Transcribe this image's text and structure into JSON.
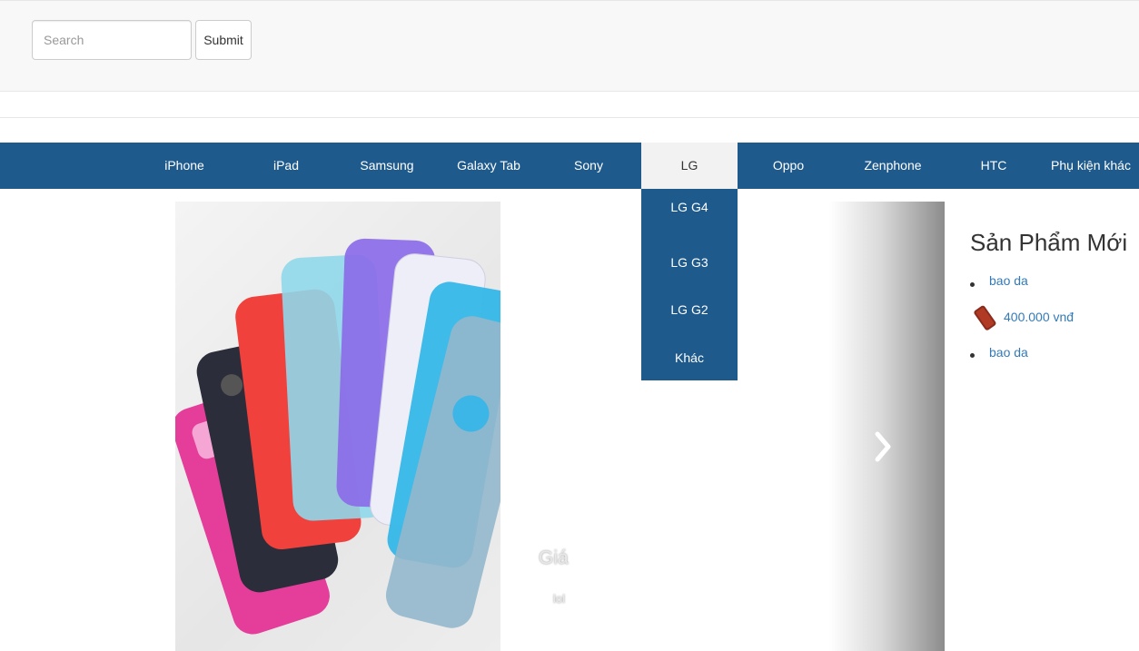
{
  "search": {
    "placeholder": "Search",
    "submit_label": "Submit"
  },
  "nav": {
    "items": [
      {
        "label": "iPhone"
      },
      {
        "label": "iPad"
      },
      {
        "label": "Samsung"
      },
      {
        "label": "Galaxy Tab"
      },
      {
        "label": "Sony"
      },
      {
        "label": "LG"
      },
      {
        "label": "Oppo"
      },
      {
        "label": "Zenphone"
      },
      {
        "label": "HTC"
      },
      {
        "label": "Phụ kiện khác"
      }
    ],
    "active": "LG"
  },
  "dropdown": {
    "items": [
      {
        "label": "LG G4"
      },
      {
        "label": "LG G3"
      },
      {
        "label": "LG G2"
      },
      {
        "label": "Khác"
      }
    ]
  },
  "carousel": {
    "caption_title": "Giá",
    "caption_value": "lol"
  },
  "sidebar": {
    "title": "Sản Phẩm Mới",
    "items": [
      {
        "name": "bao da"
      },
      {
        "price": "400.000 vnđ"
      },
      {
        "name": "bao da"
      }
    ]
  },
  "colors": {
    "nav_background": "#1f5a8c",
    "link": "#337ab7",
    "active_tab_background": "#f2f2f2"
  }
}
